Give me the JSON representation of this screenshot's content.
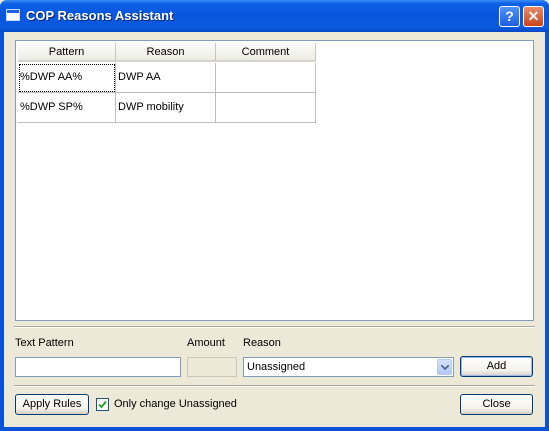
{
  "window": {
    "title": "COP Reasons Assistant",
    "help_glyph": "?",
    "close_glyph": "✕"
  },
  "table": {
    "columns": [
      "Pattern",
      "Reason",
      "Comment"
    ],
    "rows": [
      {
        "pattern": "%DWP AA%",
        "reason": "DWP AA",
        "comment": ""
      },
      {
        "pattern": "%DWP SP%",
        "reason": "DWP mobility",
        "comment": ""
      }
    ]
  },
  "form": {
    "text_pattern_label": "Text Pattern",
    "text_pattern_value": "",
    "amount_label": "Amount",
    "amount_value": "",
    "reason_label": "Reason",
    "reason_value": "Unassigned",
    "add_label": "Add"
  },
  "footer": {
    "apply_rules_label": "Apply Rules",
    "only_unassigned_label": "Only change Unassigned",
    "only_unassigned_checked": true,
    "close_label": "Close"
  },
  "icons": {
    "window_icon": "window-app-icon",
    "help": "help-icon",
    "close": "close-icon",
    "dropdown": "chevron-down-icon",
    "check": "checkmark-icon"
  },
  "colors": {
    "title_bar": "#0a5fe8",
    "client_bg": "#ece9d8",
    "close_button": "#c9451b"
  }
}
